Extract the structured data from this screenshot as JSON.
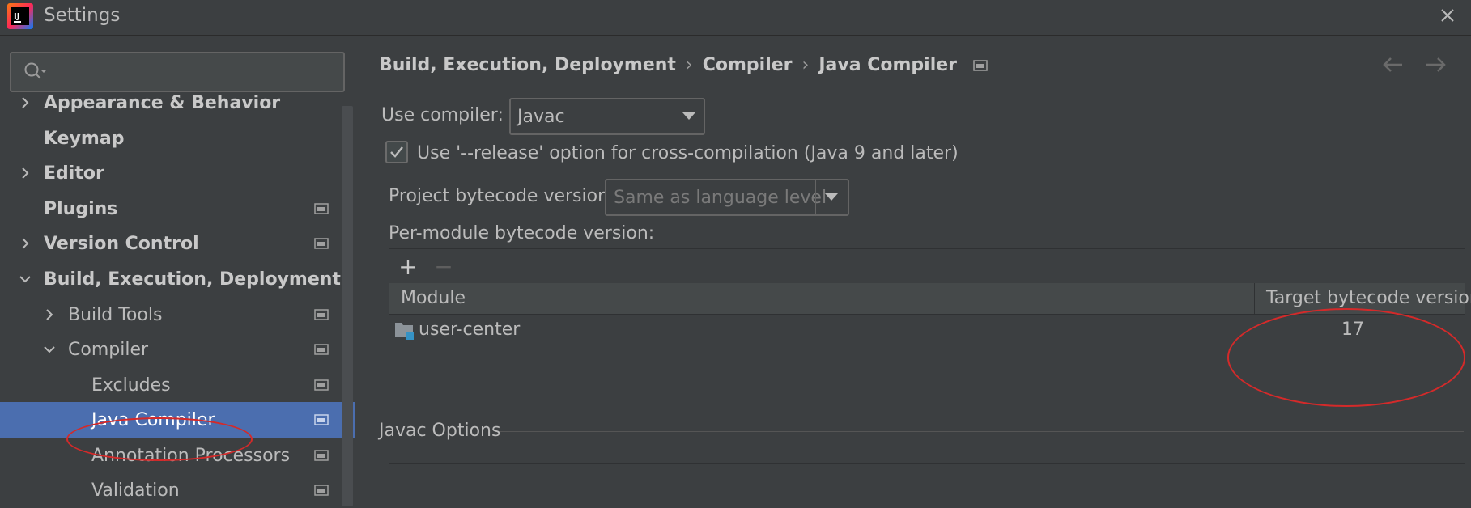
{
  "window": {
    "title": "Settings"
  },
  "search": {
    "placeholder": ""
  },
  "tree": {
    "items": [
      {
        "label": "Appearance & Behavior",
        "expanded": false,
        "level": 0,
        "has_children": true
      },
      {
        "label": "Keymap",
        "level": 0,
        "has_children": false
      },
      {
        "label": "Editor",
        "expanded": false,
        "level": 0,
        "has_children": true
      },
      {
        "label": "Plugins",
        "level": 0,
        "has_children": false
      },
      {
        "label": "Version Control",
        "expanded": false,
        "level": 0,
        "has_children": true
      },
      {
        "label": "Build, Execution, Deployment",
        "expanded": true,
        "level": 0,
        "has_children": true
      },
      {
        "label": "Build Tools",
        "expanded": false,
        "level": 1,
        "has_children": true
      },
      {
        "label": "Compiler",
        "expanded": true,
        "level": 1,
        "has_children": true
      },
      {
        "label": "Excludes",
        "level": 2,
        "has_children": false
      },
      {
        "label": "Java Compiler",
        "level": 2,
        "has_children": false,
        "selected": true
      },
      {
        "label": "Annotation Processors",
        "level": 2,
        "has_children": false
      },
      {
        "label": "Validation",
        "level": 2,
        "has_children": false
      }
    ]
  },
  "breadcrumb": [
    "Build, Execution, Deployment",
    "Compiler",
    "Java Compiler"
  ],
  "form": {
    "use_compiler_label": "Use compiler:",
    "use_compiler_value": "Javac",
    "release_option_checked": true,
    "release_option_label": "Use '--release' option for cross-compilation (Java 9 and later)",
    "project_bytecode_label": "Project bytecode version:",
    "project_bytecode_value": "Same as language level",
    "per_module_label": "Per-module bytecode version:"
  },
  "table": {
    "add_label": "+",
    "remove_label": "−",
    "columns": [
      "Module",
      "Target bytecode version"
    ],
    "rows": [
      {
        "module": "user-center",
        "version": "17"
      }
    ]
  },
  "javac_options": {
    "title": "Javac Options"
  },
  "colors": {
    "background": "#3c3f41",
    "selection": "#4b6eaf",
    "annotation": "#d42a2a"
  }
}
